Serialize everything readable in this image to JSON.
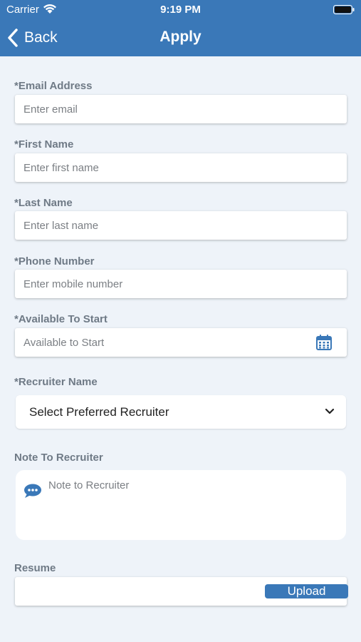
{
  "status_bar": {
    "carrier": "Carrier",
    "time": "9:19 PM"
  },
  "nav": {
    "back_label": "Back",
    "title": "Apply"
  },
  "form": {
    "email": {
      "label": "*Email Address",
      "placeholder": "Enter email",
      "value": ""
    },
    "first_name": {
      "label": "*First Name",
      "placeholder": "Enter first name",
      "value": ""
    },
    "last_name": {
      "label": "*Last Name",
      "placeholder": "Enter last name",
      "value": ""
    },
    "phone": {
      "label": "*Phone Number",
      "placeholder": "Enter mobile number",
      "value": ""
    },
    "start": {
      "label": "*Available To Start",
      "placeholder": "Available to Start",
      "value": ""
    },
    "recruiter": {
      "label": "*Recruiter Name",
      "selected": "Select Preferred Recruiter"
    },
    "note": {
      "label": "Note To Recruiter",
      "placeholder": "Note to Recruiter"
    },
    "resume": {
      "label": "Resume",
      "upload_label": "Upload"
    }
  },
  "colors": {
    "header": "#3a78b8",
    "background": "#eef3f9",
    "label": "#6f7a86",
    "accent": "#3a78b8"
  },
  "icons": [
    "wifi-icon",
    "battery-icon",
    "back-chevron-icon",
    "calendar-icon",
    "chevron-down-icon",
    "chat-icon"
  ]
}
